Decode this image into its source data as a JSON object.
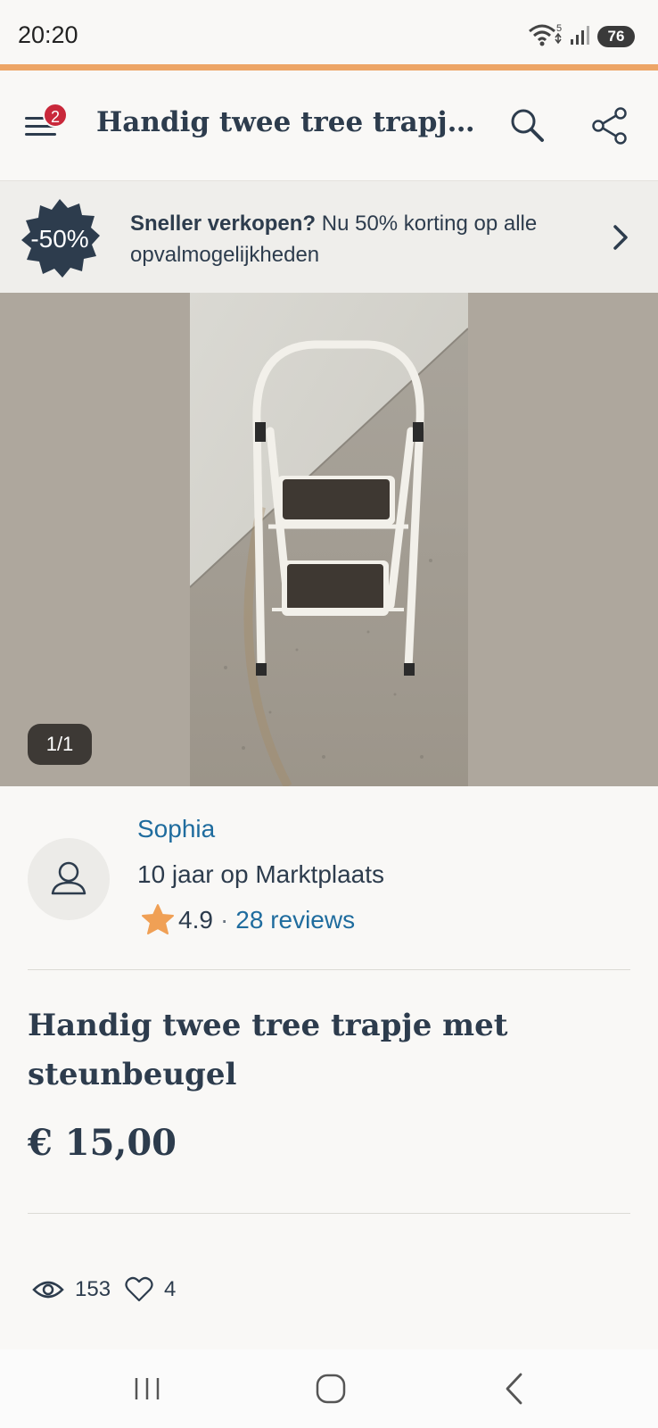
{
  "status_bar": {
    "time": "20:20",
    "battery": "76",
    "wifi_badge": "5",
    "icons": [
      "wifi-icon",
      "signal-icon",
      "battery-icon"
    ]
  },
  "header": {
    "title": "Handig twee tree trapje met steunbeugel",
    "menu_badge": "2",
    "icons": [
      "menu-icon",
      "search-icon",
      "share-icon"
    ]
  },
  "promo": {
    "badge": "-50%",
    "bold_text": "Sneller verkopen?",
    "text": " Nu 50% korting op alle opvalmogelijkheden"
  },
  "gallery": {
    "counter": "1/1"
  },
  "seller": {
    "name": "Sophia",
    "since": "10 jaar op Marktplaats",
    "rating": "4.9",
    "separator": "·",
    "reviews": "28 reviews"
  },
  "listing": {
    "title": "Handig twee tree trapje met steunbeugel",
    "price": "€ 15,00"
  },
  "stats": {
    "views": "153",
    "favorites": "4"
  },
  "colors": {
    "accent": "#eda566",
    "link": "#1f6c9e",
    "text": "#2d3c4d",
    "badge": "#c9283a",
    "star": "#f0a055"
  }
}
